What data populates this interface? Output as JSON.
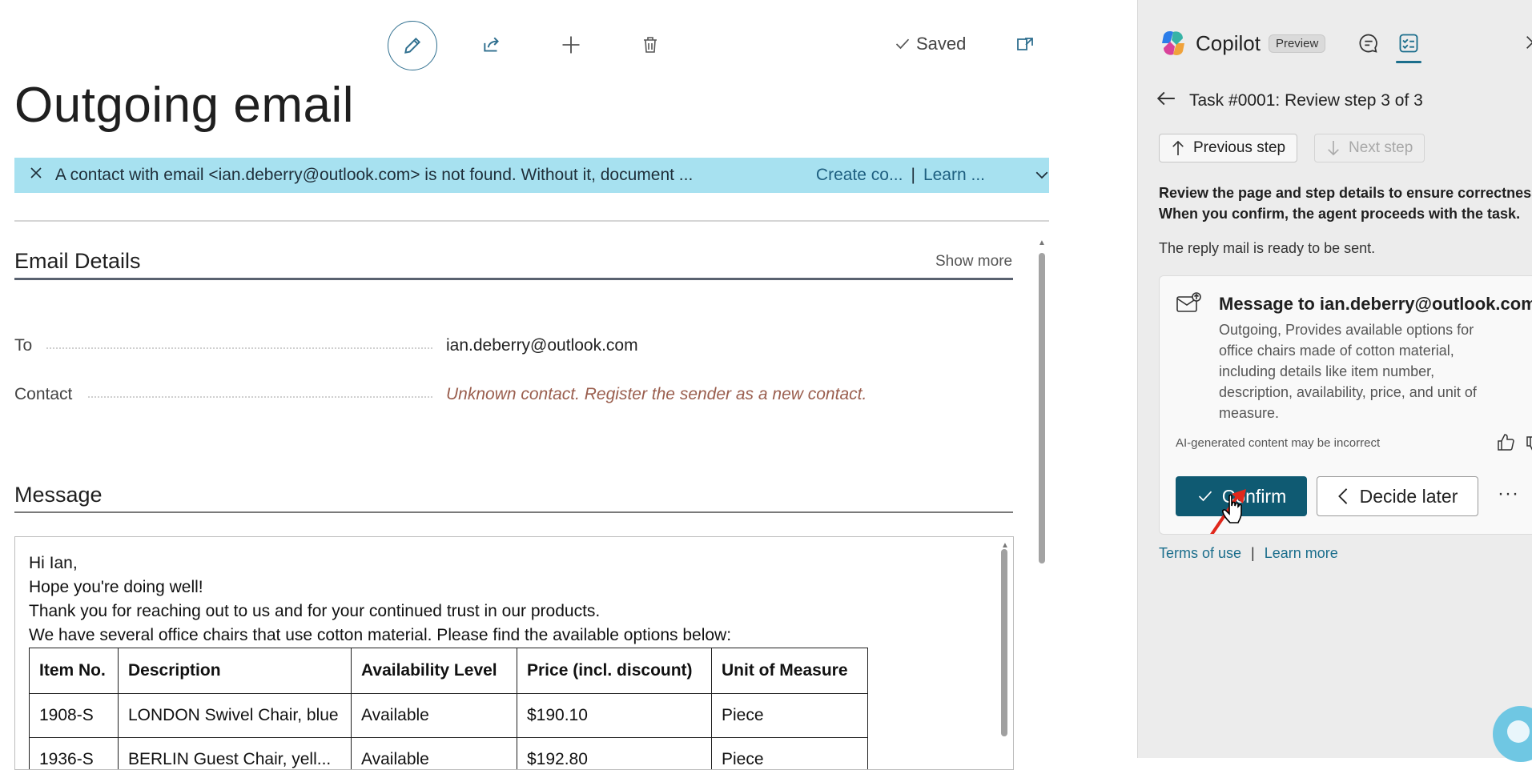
{
  "header": {
    "saved_label": "Saved",
    "page_title": "Outgoing email"
  },
  "banner": {
    "message": "A contact with email <ian.deberry@outlook.com> is not found. Without it, document ...",
    "action_create": "Create co...",
    "separator": "|",
    "action_learn": "Learn ..."
  },
  "email_details": {
    "section_title": "Email Details",
    "show_more": "Show more",
    "to_label": "To",
    "to_value": "ian.deberry@outlook.com",
    "contact_label": "Contact",
    "contact_value": "Unknown contact. Register the sender as a new contact."
  },
  "message": {
    "section_title": "Message",
    "lines": [
      "Hi Ian,",
      "Hope you're doing well!",
      "Thank you for reaching out to us and for your continued trust in our products.",
      "We have several office chairs that use cotton material. Please find the available options below:"
    ],
    "table": {
      "headers": [
        "Item No.",
        "Description",
        "Availability Level",
        "Price (incl. discount)",
        "Unit of Measure"
      ],
      "rows": [
        [
          "1908-S",
          "LONDON Swivel Chair, blue",
          "Available",
          "$190.10",
          "Piece"
        ],
        [
          "1936-S",
          "BERLIN Guest Chair, yell...",
          "Available",
          "$192.80",
          "Piece"
        ]
      ]
    }
  },
  "copilot": {
    "title": "Copilot",
    "badge": "Preview",
    "task_title": "Task #0001: Review step 3 of 3",
    "previous_step": "Previous step",
    "next_step": "Next step",
    "review_line1": "Review the page and step details to ensure correctness.",
    "review_line2": "When you confirm, the agent proceeds with the task.",
    "ready_text": "The reply mail is ready to be sent.",
    "card": {
      "title": "Message to ian.deberry@outlook.com",
      "description": "Outgoing, Provides available options for office chairs made of cotton material, including details like item number, description, availability, price, and unit of measure.",
      "ai_note": "AI-generated content may be incorrect",
      "confirm": "Confirm",
      "decide_later": "Decide later",
      "more": "···"
    },
    "terms": "Terms of use",
    "footer_sep": "|",
    "learn_more": "Learn more"
  },
  "colors": {
    "accent": "#0f5a72",
    "banner": "#a7e1f0",
    "link": "#1b6e8c",
    "warning_text": "#9a5e4e"
  }
}
